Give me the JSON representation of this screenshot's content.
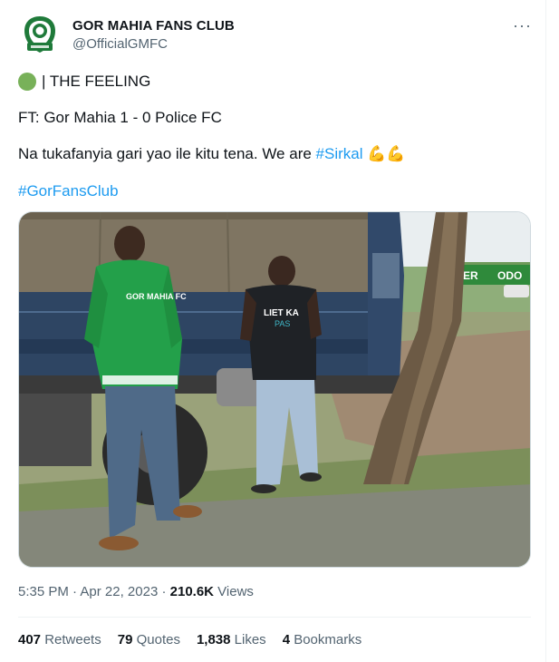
{
  "author": {
    "display_name": "GOR MAHIA FANS CLUB",
    "handle": "@OfficialGMFC"
  },
  "more_button": "···",
  "tweet": {
    "line1_text": "| THE FEELING",
    "line2_text": "FT: Gor Mahia 1 - 0 Police FC",
    "line3_text": "Na tukafanyia gari yao ile kitu tena. We are ",
    "line3_hashtag": "#Sirkal",
    "line3_emoji": "💪💪",
    "line4_hashtag": "#GorFansClub"
  },
  "photo": {
    "jacket_text": "GOR MAHIA FC",
    "shirt_text_1": "LIET KA",
    "shirt_text_2": "PAS",
    "sign_text": "ER",
    "sign_text_2": "ODO"
  },
  "meta": {
    "time": "5:35 PM",
    "sep1": " · ",
    "date": "Apr 22, 2023",
    "sep2": " · ",
    "views_count": "210.6K",
    "views_label": " Views"
  },
  "stats": {
    "retweets_count": "407",
    "retweets_label": " Retweets",
    "quotes_count": "79",
    "quotes_label": " Quotes",
    "likes_count": "1,838",
    "likes_label": " Likes",
    "bookmarks_count": "4",
    "bookmarks_label": " Bookmarks"
  },
  "colors": {
    "link": "#1d9bf0",
    "secondary_text": "#536471",
    "logo_green": "#1f7a3a"
  }
}
